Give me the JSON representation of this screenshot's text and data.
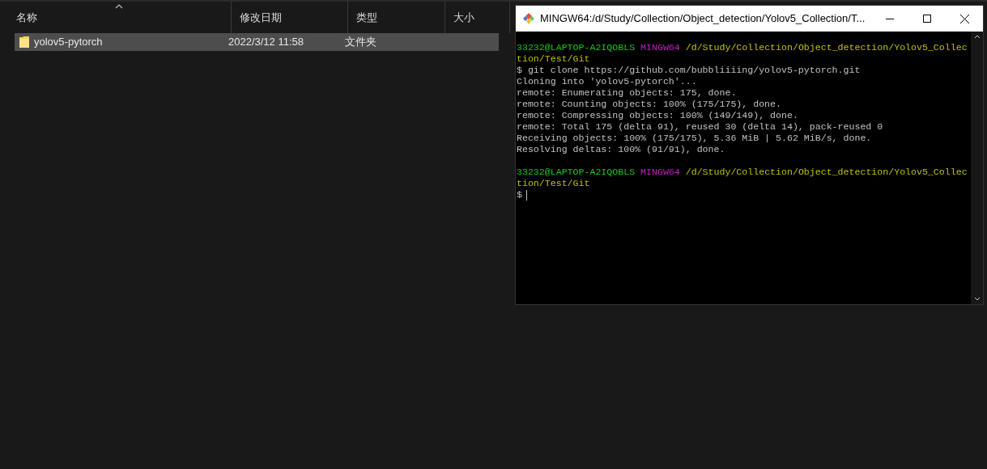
{
  "explorer": {
    "columns": [
      {
        "label": "名称",
        "sorted": true
      },
      {
        "label": "修改日期",
        "sorted": false
      },
      {
        "label": "类型",
        "sorted": false
      },
      {
        "label": "大小",
        "sorted": false
      }
    ],
    "rows": [
      {
        "name": "yolov5-pytorch",
        "modified": "2022/3/12 11:58",
        "type": "文件夹",
        "selected": true
      }
    ]
  },
  "terminal": {
    "title": "MINGW64:/d/Study/Collection/Object_detection/Yolov5_Collection/T...",
    "lines": [
      {
        "kind": "prompt",
        "user": "33232@LAPTOP-A2IQOBLS",
        "shell": "MINGW64",
        "path": "/d/Study/Collection/Object_detection/Yolov5_Collection/Test/Git"
      },
      {
        "kind": "output",
        "text": "$ git clone https://github.com/bubbliiiing/yolov5-pytorch.git"
      },
      {
        "kind": "output",
        "text": "Cloning into 'yolov5-pytorch'..."
      },
      {
        "kind": "output",
        "text": "remote: Enumerating objects: 175, done."
      },
      {
        "kind": "output",
        "text": "remote: Counting objects: 100% (175/175), done."
      },
      {
        "kind": "output",
        "text": "remote: Compressing objects: 100% (149/149), done."
      },
      {
        "kind": "output",
        "text": "remote: Total 175 (delta 91), reused 30 (delta 14), pack-reused 0"
      },
      {
        "kind": "output",
        "text": "Receiving objects: 100% (175/175), 5.36 MiB | 5.62 MiB/s, done."
      },
      {
        "kind": "output",
        "text": "Resolving deltas: 100% (91/91), done."
      },
      {
        "kind": "blank"
      },
      {
        "kind": "prompt",
        "user": "33232@LAPTOP-A2IQOBLS",
        "shell": "MINGW64",
        "path": "/d/Study/Collection/Object_detection/Yolov5_Collection/Test/Git"
      },
      {
        "kind": "input",
        "text": "$"
      }
    ]
  }
}
